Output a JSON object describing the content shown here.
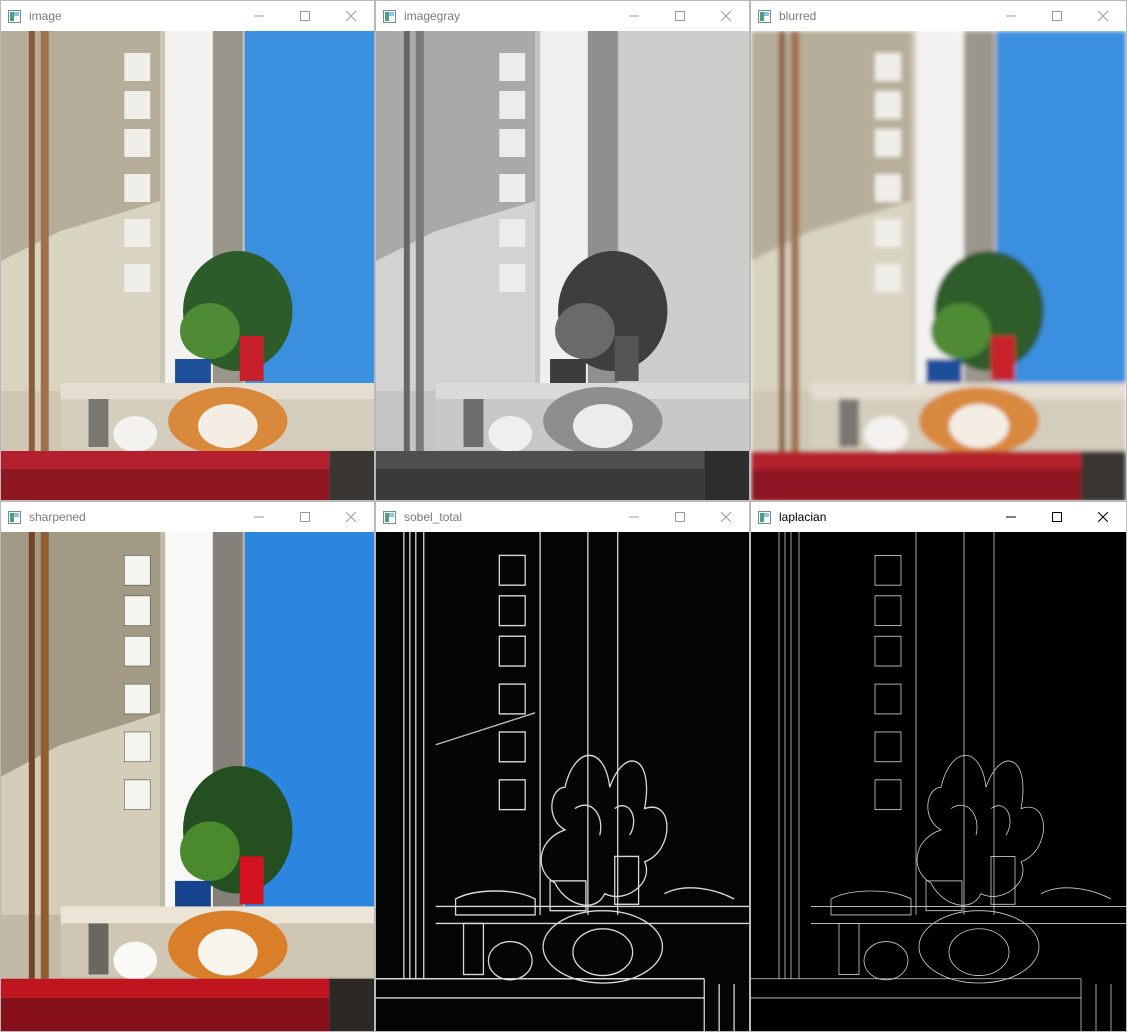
{
  "windows": [
    {
      "title": "image",
      "filter": "color"
    },
    {
      "title": "imagegray",
      "filter": "gray"
    },
    {
      "title": "blurred",
      "filter": "blur"
    },
    {
      "title": "sharpened",
      "filter": "sharp"
    },
    {
      "title": "sobel_total",
      "filter": "edges"
    },
    {
      "title": "laplacian",
      "filter": "edges-fine"
    }
  ],
  "active_window": 5,
  "icons": {
    "app": "window-app-icon",
    "minimize": "minimize-icon",
    "maximize": "maximize-icon",
    "close": "close-icon"
  },
  "colors": {
    "sky": "#3a8fdf",
    "wall": "#d8d2c2",
    "table": "#b5202e",
    "cat": "#d8893c",
    "pot": "#1d4f9a",
    "edge": "#e8e8e8"
  }
}
